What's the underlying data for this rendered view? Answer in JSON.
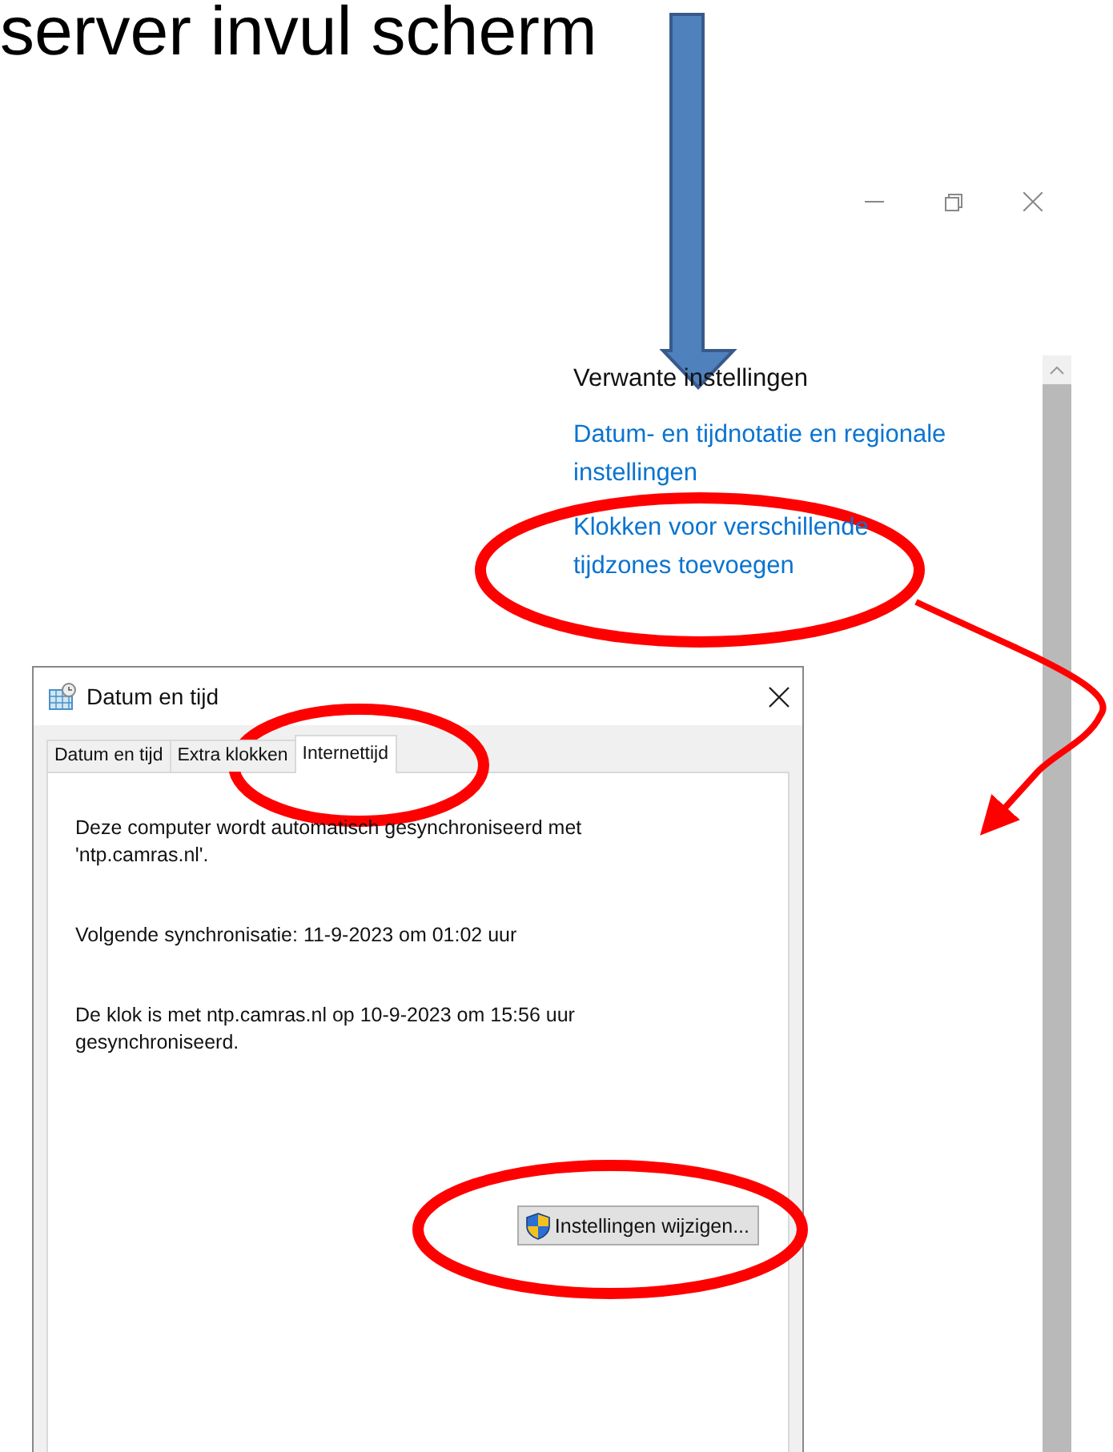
{
  "slide_title": "server invul scherm",
  "settings_window": {
    "section_heading": "Verwante instellingen",
    "links": [
      {
        "lines": [
          "Datum- en tijdnotatie en regionale",
          "instellingen"
        ]
      },
      {
        "lines": [
          "Klokken voor verschillende",
          "tijdzones toevoegen"
        ]
      }
    ]
  },
  "dialog": {
    "title": "Datum en tijd",
    "tabs": [
      {
        "label": "Datum en tijd",
        "selected": false
      },
      {
        "label": "Extra klokken",
        "selected": false
      },
      {
        "label": "Internettijd",
        "selected": true
      }
    ],
    "paragraphs": [
      {
        "lines": [
          "Deze computer wordt automatisch gesynchroniseerd met",
          "'ntp.camras.nl'."
        ]
      },
      {
        "lines": [
          "Volgende synchronisatie: 11-9-2023 om 01:02 uur"
        ]
      },
      {
        "lines": [
          "De klok is met ntp.camras.nl op 10-9-2023 om 15:56 uur",
          "gesynchroniseerd."
        ]
      }
    ],
    "button": "Instellingen wijzigen..."
  }
}
